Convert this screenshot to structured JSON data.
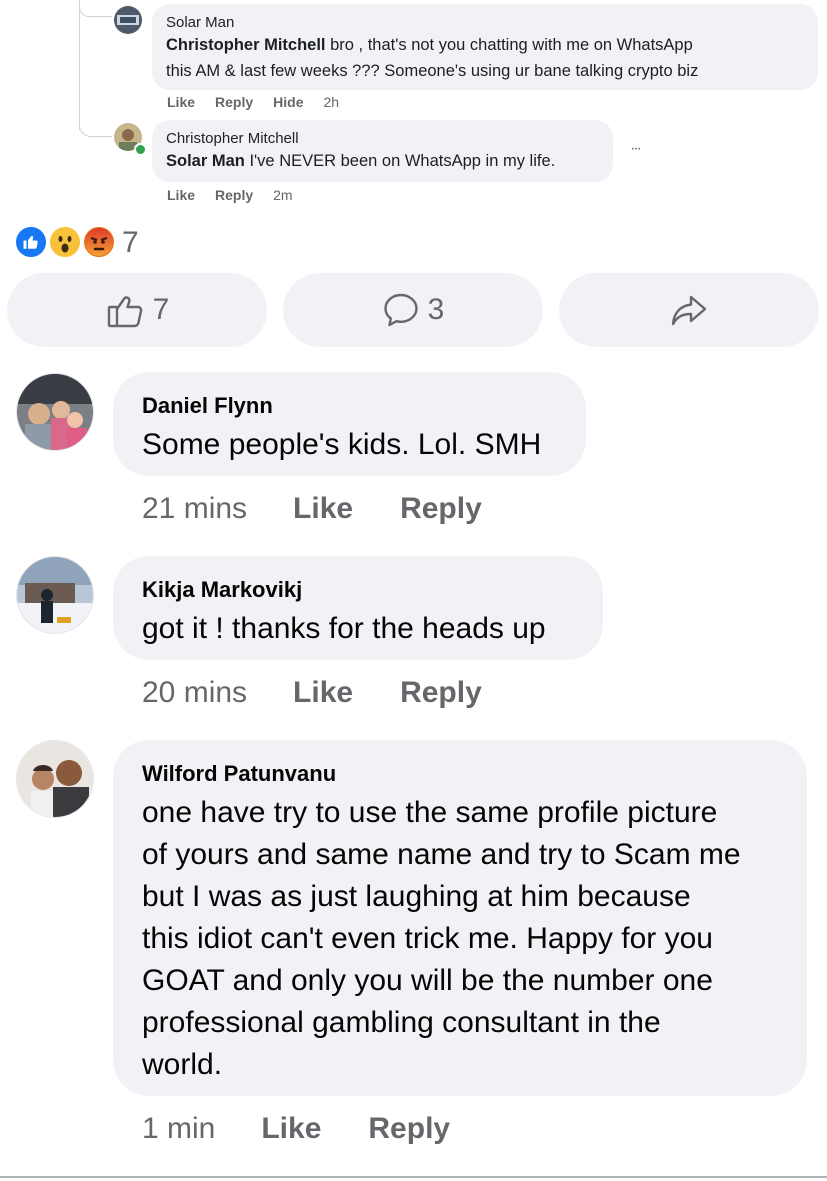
{
  "embedded": {
    "comment1": {
      "author": "Solar Man",
      "mention": "Christopher Mitchell",
      "text_line1": " bro , that's not you chatting with me on WhatsApp",
      "text_line2": "this AM & last few weeks ??? Someone's using ur bane talking crypto biz",
      "like": "Like",
      "reply": "Reply",
      "hide": "Hide",
      "time": "2h"
    },
    "comment2": {
      "author": "Christopher Mitchell",
      "mention": "Solar Man",
      "text": " I've NEVER been on WhatsApp in my life.",
      "like": "Like",
      "reply": "Reply",
      "time": "2m",
      "more": "···"
    }
  },
  "reactions": {
    "count": "7",
    "icons": [
      "like-icon",
      "wow-icon",
      "angry-icon"
    ]
  },
  "action_bar": {
    "like_count": "7",
    "comment_count": "3"
  },
  "comments": [
    {
      "author": "Daniel Flynn",
      "text": "Some people's kids. Lol. SMH",
      "time": "21 mins",
      "like": "Like",
      "reply": "Reply"
    },
    {
      "author": "Kikja Markovikj",
      "text": "got it ! thanks for the heads up",
      "time": "20 mins",
      "like": "Like",
      "reply": "Reply"
    },
    {
      "author": "Wilford Patunvanu",
      "lines": [
        "one have try to use the same profile picture",
        "of yours and same name and try to Scam me",
        "but I was as just laughing at him because",
        "this idiot can't even trick me. Happy for you",
        "GOAT and only you will be the number one",
        "professional gambling consultant in the",
        "world."
      ],
      "time": "1 min",
      "like": "Like",
      "reply": "Reply"
    }
  ],
  "colors": {
    "accent": "#1877f2",
    "bubble": "#f0f2f5",
    "muted": "#65676b"
  }
}
